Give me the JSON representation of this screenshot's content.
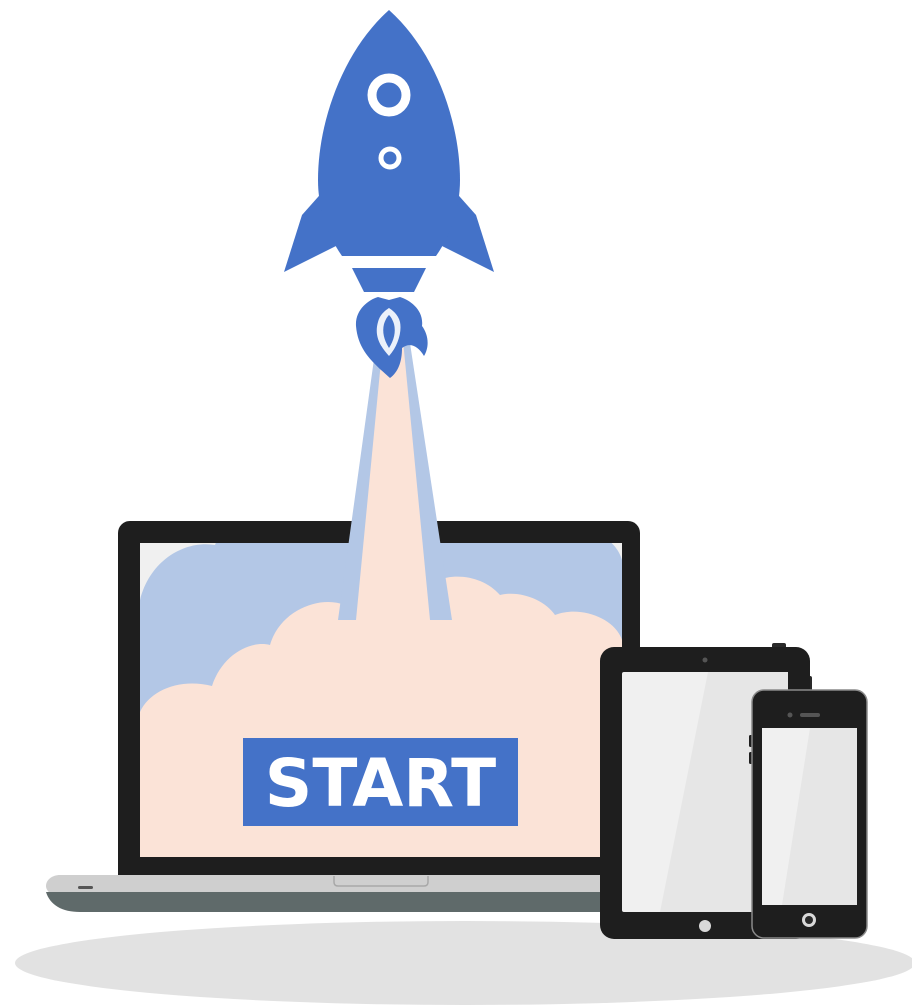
{
  "start_button": {
    "label": "START"
  },
  "icons": {
    "rocket": "rocket-icon",
    "laptop": "laptop-icon",
    "tablet": "tablet-icon",
    "smartphone": "smartphone-icon"
  },
  "colors": {
    "rocket_blue": "#4472c8",
    "smoke_blue": "#b3c7e6",
    "smoke_peach": "#fbe3d7",
    "device_frame": "#1e1e1e",
    "screen_light": "#f0f0f0",
    "laptop_base": "#cfcfcf",
    "laptop_base_shadow": "#5f6a6a",
    "ground_shadow": "#e2e2e2",
    "start_bg": "#4472c8",
    "start_text": "#ffffff"
  }
}
